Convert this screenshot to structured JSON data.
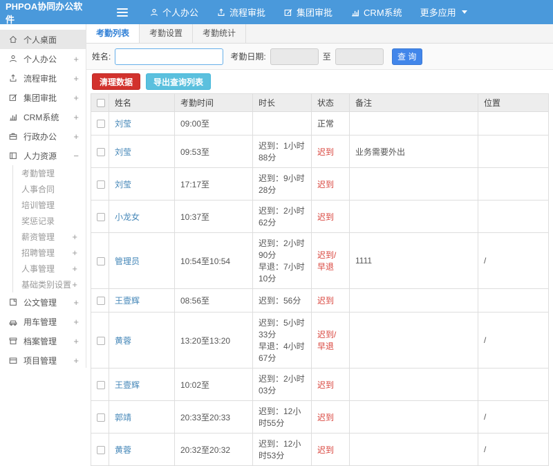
{
  "colors": {
    "navbar_blue": "#4a99db",
    "query_blue": "#4286ea",
    "danger_red": "#d2322d",
    "info_teal": "#5bc0de",
    "link_blue": "#4587b8",
    "status_red": "#d9443c"
  },
  "navbar": {
    "logo": "PHPOA协同办公软件",
    "items": [
      {
        "label": "个人办公",
        "icon": "user-icon"
      },
      {
        "label": "流程审批",
        "icon": "upload-icon"
      },
      {
        "label": "集团审批",
        "icon": "edit-icon"
      },
      {
        "label": "CRM系统",
        "icon": "bar-chart-icon"
      },
      {
        "label": "更多应用",
        "icon": "caret-down-icon"
      }
    ]
  },
  "sidebar": {
    "items": [
      {
        "label": "个人桌面",
        "icon": "home-icon",
        "expander": "",
        "active": true
      },
      {
        "label": "个人办公",
        "icon": "user-icon",
        "expander": "+"
      },
      {
        "label": "流程审批",
        "icon": "upload-icon",
        "expander": "+"
      },
      {
        "label": "集团审批",
        "icon": "edit-icon",
        "expander": "+"
      },
      {
        "label": "CRM系统",
        "icon": "bar-chart-icon",
        "expander": "+"
      },
      {
        "label": "行政办公",
        "icon": "briefcase-icon",
        "expander": "+"
      },
      {
        "label": "人力资源",
        "icon": "card-icon",
        "expander": "−",
        "children": [
          {
            "label": "考勤管理",
            "expander": ""
          },
          {
            "label": "人事合同",
            "expander": ""
          },
          {
            "label": "培训管理",
            "expander": ""
          },
          {
            "label": "奖惩记录",
            "expander": ""
          },
          {
            "label": "薪资管理",
            "expander": "+"
          },
          {
            "label": "招聘管理",
            "expander": "+"
          },
          {
            "label": "人事管理",
            "expander": "+"
          },
          {
            "label": "基础类别设置",
            "expander": "+"
          }
        ]
      },
      {
        "label": "公文管理",
        "icon": "document-icon",
        "expander": "+"
      },
      {
        "label": "用车管理",
        "icon": "car-icon",
        "expander": "+"
      },
      {
        "label": "档案管理",
        "icon": "archive-icon",
        "expander": "+"
      },
      {
        "label": "项目管理",
        "icon": "folder-icon",
        "expander": "+"
      }
    ]
  },
  "tabs": [
    {
      "label": "考勤列表",
      "active": true
    },
    {
      "label": "考勤设置",
      "active": false
    },
    {
      "label": "考勤统计",
      "active": false
    }
  ],
  "search": {
    "name_label": "姓名:",
    "name_value": "",
    "date_label": "考勤日期:",
    "date_from_value": "",
    "to_label": "至",
    "date_to_value": "",
    "query_button": "查 询"
  },
  "toolbar": {
    "clean_button": "清理数据",
    "export_button": "导出查询列表"
  },
  "table": {
    "columns": [
      "姓名",
      "考勤时间",
      "时长",
      "状态",
      "备注",
      "位置"
    ],
    "rows": [
      {
        "name": "刘莹",
        "time": "09:00至",
        "duration1": "",
        "duration2": "",
        "status": "正常",
        "status_type": "normal",
        "remark": "",
        "location": ""
      },
      {
        "name": "刘莹",
        "time": "09:53至",
        "duration1": "迟到：1小时88分",
        "duration2": "",
        "status": "迟到",
        "status_type": "late",
        "remark": "业务需要外出",
        "location": ""
      },
      {
        "name": "刘莹",
        "time": "17:17至",
        "duration1": "迟到：9小时28分",
        "duration2": "",
        "status": "迟到",
        "status_type": "late",
        "remark": "",
        "location": ""
      },
      {
        "name": "小龙女",
        "time": "10:37至",
        "duration1": "迟到：2小时62分",
        "duration2": "",
        "status": "迟到",
        "status_type": "late",
        "remark": "",
        "location": ""
      },
      {
        "name": "管理员",
        "time": "10:54至10:54",
        "duration1": "迟到：2小时90分",
        "duration2": "早退：7小时10分",
        "status": "迟到/早退",
        "status_type": "late",
        "remark": "1111",
        "location": "/"
      },
      {
        "name": "王壹辉",
        "time": "08:56至",
        "duration1": "迟到：56分",
        "duration2": "",
        "status": "迟到",
        "status_type": "late",
        "remark": "",
        "location": ""
      },
      {
        "name": "黄蓉",
        "time": "13:20至13:20",
        "duration1": "迟到：5小时33分",
        "duration2": "早退：4小时67分",
        "status": "迟到/早退",
        "status_type": "late",
        "remark": "",
        "location": "/"
      },
      {
        "name": "王壹辉",
        "time": "10:02至",
        "duration1": "迟到：2小时03分",
        "duration2": "",
        "status": "迟到",
        "status_type": "late",
        "remark": "",
        "location": ""
      },
      {
        "name": "郭靖",
        "time": "20:33至20:33",
        "duration1": "迟到：12小时55分",
        "duration2": "",
        "status": "迟到",
        "status_type": "late",
        "remark": "",
        "location": "/"
      },
      {
        "name": "黄蓉",
        "time": "20:32至20:32",
        "duration1": "迟到：12小时53分",
        "duration2": "",
        "status": "迟到",
        "status_type": "late",
        "remark": "",
        "location": "/"
      }
    ]
  }
}
